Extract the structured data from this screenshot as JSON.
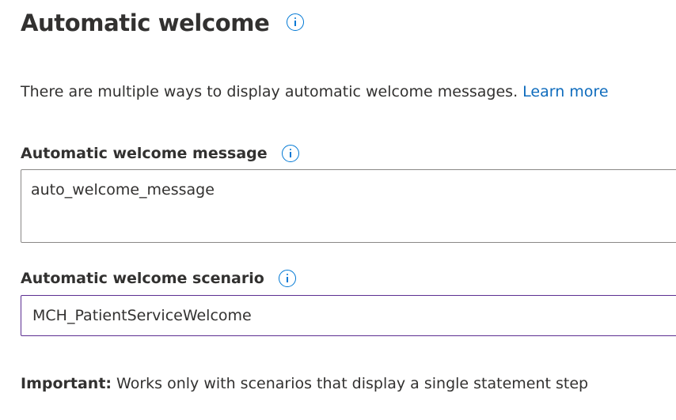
{
  "header": {
    "title": "Automatic welcome"
  },
  "description": {
    "text": "There are multiple ways to display automatic welcome messages. ",
    "link_label": "Learn more"
  },
  "welcome_message": {
    "label": "Automatic welcome message",
    "value": "auto_welcome_message"
  },
  "welcome_scenario": {
    "label": "Automatic welcome scenario",
    "value": "MCH_PatientServiceWelcome"
  },
  "note": {
    "prefix": "Important:",
    "text": " Works only with scenarios that display a single statement step"
  },
  "colors": {
    "link": "#0f6cbd",
    "info_icon": "#0078d4",
    "focused_border": "#5c2e91",
    "text": "#323130"
  },
  "icons": {
    "info": "info-icon"
  }
}
